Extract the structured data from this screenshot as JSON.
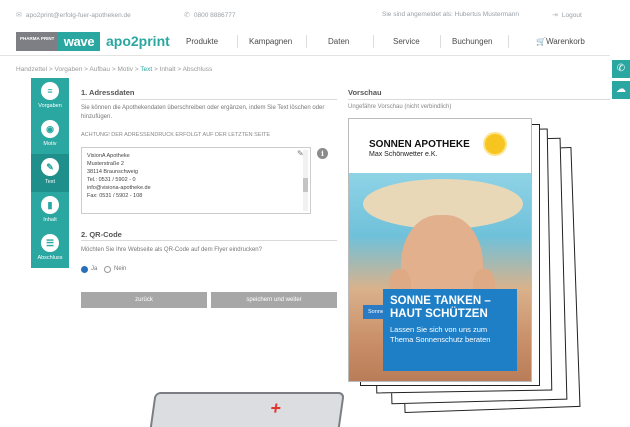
{
  "topbar": {
    "email": "apo2print@erfolg-fuer-apotheken.de",
    "phone": "0800 8886777",
    "login_status": "Sie sind angemeldet als: Hubertus Mustermann",
    "logout": "Logout"
  },
  "logo": {
    "pharma_print": "PHARMA PRINT",
    "wave": "wave",
    "apo2print": "apo2print"
  },
  "nav": {
    "items": [
      "Produkte",
      "Kampagnen",
      "Daten",
      "Service",
      "Buchungen"
    ],
    "cart": "Warenkorb"
  },
  "breadcrumb": [
    "Handzettel",
    "Vorgaben",
    "Aufbau",
    "Motiv",
    "Text",
    "Inhalt",
    "Abschluss"
  ],
  "breadcrumb_active": "Text",
  "steps": [
    {
      "label": "Vorgaben",
      "icon": "list-icon"
    },
    {
      "label": "Motiv",
      "icon": "camera-icon"
    },
    {
      "label": "Text",
      "icon": "pencil-icon"
    },
    {
      "label": "Inhalt",
      "icon": "book-icon"
    },
    {
      "label": "Abschluss",
      "icon": "check-list-icon"
    }
  ],
  "address": {
    "title": "1. Adressdaten",
    "intro": "Sie können die Apothekendaten überschreiben oder ergänzen, indem Sie Text löschen oder hinzufügen.",
    "notice": "ACHTUNG! Der Adressendruck erfolgt auf der letzten Seite",
    "lines": [
      "VisionA Apotheke",
      "Musterstraße 2",
      "38114 Braunschweig",
      "Tel.: 0531 / 5902 - 0",
      "info@visiona-apotheke.de",
      "Fax: 0531 / 5902 - 108"
    ]
  },
  "qr": {
    "title": "2. QR-Code",
    "question": "Möchten Sie Ihre Webseite als QR-Code auf dem Flyer eindrucken?",
    "yes": "Ja",
    "no": "Nein",
    "selected": "Ja"
  },
  "buttons": {
    "back": "zurück",
    "save": "speichern und weiter"
  },
  "preview": {
    "title": "Vorschau",
    "subtitle": "Ungefähre Vorschau (nicht verbindlich)",
    "pharmacy": "SONNEN APOTHEKE",
    "owner": "Max Schönwetter e.K.",
    "tag": "Sonnenschutz",
    "headline_1": "SONNE TANKEN –",
    "headline_2": "HAUT SCHÜTZEN",
    "sub_1": "Lassen Sie sich von uns zum",
    "sub_2": "Thema Sonnenschutz beraten"
  },
  "colors": {
    "accent": "#2aa7a1",
    "button": "#a7a7a7",
    "banner": "#1f7fc6",
    "radio": "#2a6fb8"
  }
}
